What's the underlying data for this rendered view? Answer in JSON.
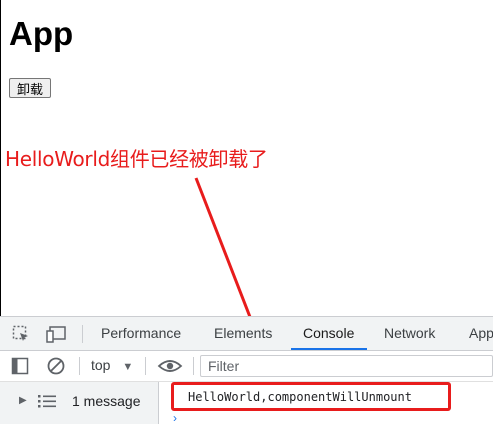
{
  "app": {
    "title": "App",
    "unmount_button": "卸载"
  },
  "annotation": {
    "text": "HelloWorld组件已经被卸载了",
    "color": "#e81c1c"
  },
  "devtools": {
    "tabs": [
      {
        "label": "Performance"
      },
      {
        "label": "Elements"
      },
      {
        "label": "Console"
      },
      {
        "label": "Network"
      },
      {
        "label": "App"
      }
    ],
    "active_tab": "Console",
    "context_select": "top",
    "filter_placeholder": "Filter",
    "sidebar_summary": "1 message",
    "log_message": "HelloWorld,componentWillUnmount",
    "accent_color": "#1a73e8"
  }
}
